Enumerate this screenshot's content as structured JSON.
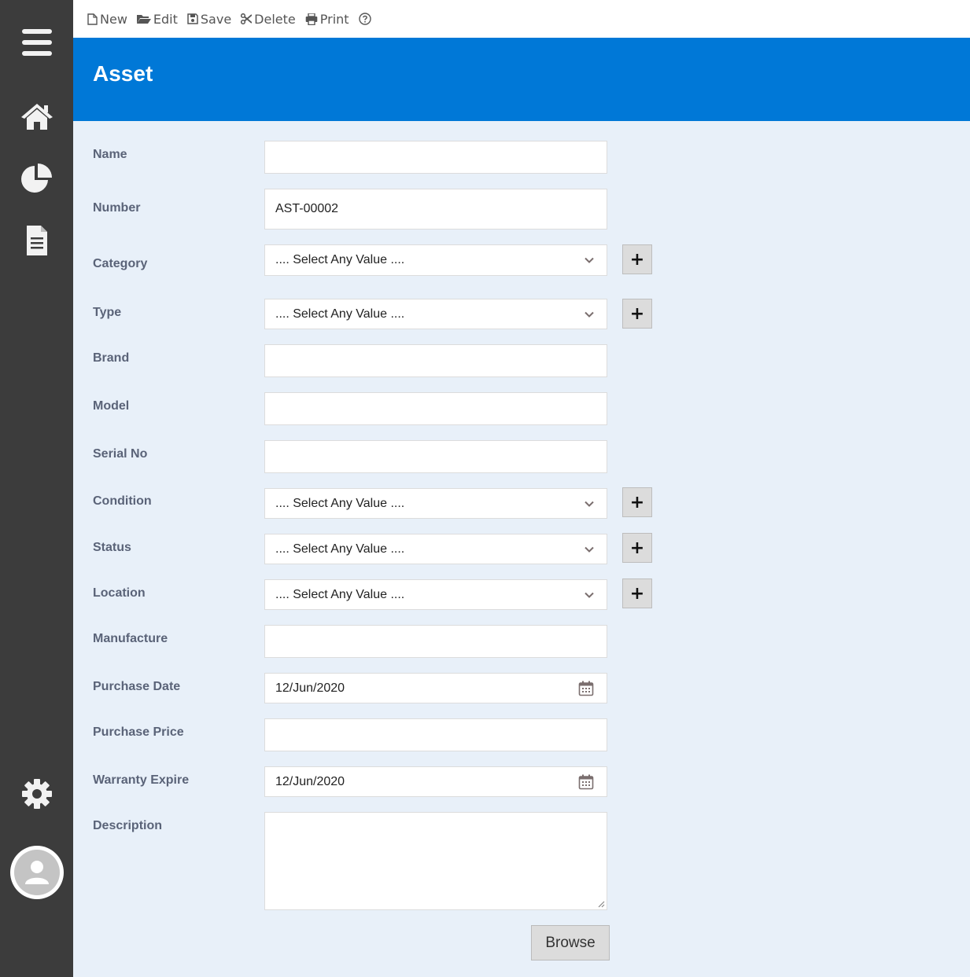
{
  "toolbar": {
    "new_label": "New",
    "edit_label": "Edit",
    "save_label": "Save",
    "delete_label": "Delete",
    "print_label": "Print"
  },
  "header": {
    "title": "Asset"
  },
  "form": {
    "name": {
      "label": "Name",
      "value": ""
    },
    "number": {
      "label": "Number",
      "value": "AST-00002"
    },
    "category": {
      "label": "Category",
      "value": ".... Select Any Value ...."
    },
    "type": {
      "label": "Type",
      "value": ".... Select Any Value ...."
    },
    "brand": {
      "label": "Brand",
      "value": ""
    },
    "model": {
      "label": "Model",
      "value": ""
    },
    "serial_no": {
      "label": "Serial No",
      "value": ""
    },
    "condition": {
      "label": "Condition",
      "value": ".... Select Any Value ...."
    },
    "status": {
      "label": "Status",
      "value": ".... Select Any Value ...."
    },
    "location": {
      "label": "Location",
      "value": ".... Select Any Value ...."
    },
    "manufacture": {
      "label": "Manufacture",
      "value": ""
    },
    "purchase_date": {
      "label": "Purchase Date",
      "value": "12/Jun/2020"
    },
    "purchase_price": {
      "label": "Purchase Price",
      "value": ""
    },
    "warranty_expire": {
      "label": "Warranty Expire",
      "value": "12/Jun/2020"
    },
    "description": {
      "label": "Description",
      "value": ""
    },
    "add_button_label": "+",
    "browse_label": "Browse"
  },
  "colors": {
    "sidebar": "#3c3c3c",
    "header": "#0078d7",
    "content_bg": "#e8f0f9",
    "label": "#5a6378"
  }
}
